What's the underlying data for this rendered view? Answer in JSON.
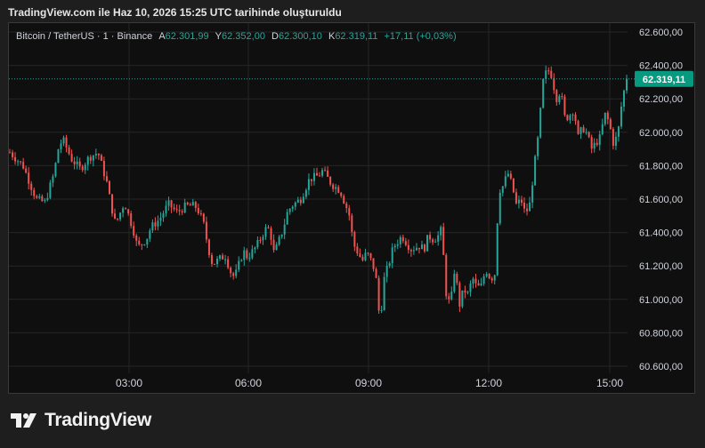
{
  "caption": "TradingView.com ile Haz 10, 2026 15:25 UTC tarihinde oluşturuldu",
  "legend": {
    "symbol": "Bitcoin / TetherUS · 1 · Binance",
    "open_label": "A",
    "open_value": "62.301,99",
    "high_label": "Y",
    "high_value": "62.352,00",
    "low_label": "D",
    "low_value": "62.300,10",
    "close_label": "K",
    "close_value": "62.319,11",
    "change": "+17,11 (+0,03%)"
  },
  "brand": {
    "name": "TradingView"
  },
  "colors": {
    "up": "#26a69a",
    "down": "#ef5350",
    "background": "#0f0f0f",
    "grid": "#262626",
    "price_badge": "#089981"
  },
  "chart_data": {
    "type": "candlestick",
    "x_ticks": [
      "03:00",
      "06:00",
      "09:00",
      "12:00",
      "15:00"
    ],
    "y_ticks": [
      "62.600,00",
      "62.400,00",
      "62.200,00",
      "62.000,00",
      "61.800,00",
      "61.600,00",
      "61.400,00",
      "61.200,00",
      "61.000,00",
      "60.800,00",
      "60.600,00"
    ],
    "ylim": [
      60600,
      62600
    ],
    "last_price": 62319.11,
    "last_price_label": "62.319,11",
    "grid": true,
    "series_close_path": [
      [
        0,
        61880
      ],
      [
        3,
        61800
      ],
      [
        6,
        61600
      ],
      [
        8,
        61580
      ],
      [
        10,
        61750
      ],
      [
        11,
        61900
      ],
      [
        12,
        61960
      ],
      [
        14,
        61840
      ],
      [
        16,
        61780
      ],
      [
        18,
        61850
      ],
      [
        20,
        61880
      ],
      [
        22,
        61700
      ],
      [
        23,
        61560
      ],
      [
        24,
        61450
      ],
      [
        26,
        61580
      ],
      [
        28,
        61420
      ],
      [
        29,
        61310
      ],
      [
        31,
        61360
      ],
      [
        32,
        61430
      ],
      [
        34,
        61480
      ],
      [
        36,
        61570
      ],
      [
        38,
        61520
      ],
      [
        40,
        61560
      ],
      [
        42,
        61560
      ],
      [
        43,
        61520
      ],
      [
        44,
        61450
      ],
      [
        45,
        61310
      ],
      [
        46,
        61210
      ],
      [
        48,
        61250
      ],
      [
        49,
        61260
      ],
      [
        50,
        61170
      ],
      [
        51,
        61130
      ],
      [
        52,
        61210
      ],
      [
        53,
        61290
      ],
      [
        54,
        61250
      ],
      [
        56,
        61320
      ],
      [
        58,
        61420
      ],
      [
        59,
        61420
      ],
      [
        60,
        61270
      ],
      [
        62,
        61420
      ],
      [
        63,
        61520
      ],
      [
        64,
        61560
      ],
      [
        66,
        61600
      ],
      [
        68,
        61720
      ],
      [
        70,
        61740
      ],
      [
        71,
        61770
      ],
      [
        73,
        61690
      ],
      [
        75,
        61650
      ],
      [
        77,
        61510
      ],
      [
        78,
        61330
      ],
      [
        80,
        61230
      ],
      [
        81,
        61280
      ],
      [
        82,
        61230
      ],
      [
        83,
        61160
      ],
      [
        84,
        60860
      ],
      [
        85,
        61130
      ],
      [
        86,
        61210
      ],
      [
        87,
        61310
      ],
      [
        89,
        61380
      ],
      [
        91,
        61300
      ],
      [
        93,
        61320
      ],
      [
        94,
        61300
      ],
      [
        95,
        61380
      ],
      [
        96,
        61360
      ],
      [
        97,
        61370
      ],
      [
        98,
        61420
      ],
      [
        99,
        61040
      ],
      [
        100,
        60960
      ],
      [
        101,
        61200
      ],
      [
        102,
        60960
      ],
      [
        103,
        61060
      ],
      [
        104,
        61030
      ],
      [
        105,
        61130
      ],
      [
        106,
        61070
      ],
      [
        107,
        61080
      ],
      [
        108,
        61180
      ],
      [
        109,
        61130
      ],
      [
        110,
        61130
      ],
      [
        111,
        61650
      ],
      [
        112,
        61680
      ],
      [
        113,
        61760
      ],
      [
        114,
        61680
      ],
      [
        115,
        61560
      ],
      [
        116,
        61600
      ],
      [
        117,
        61510
      ],
      [
        118,
        61570
      ],
      [
        119,
        61790
      ],
      [
        120,
        61990
      ],
      [
        121,
        62300
      ],
      [
        122,
        62380
      ],
      [
        123,
        62340
      ],
      [
        124,
        62200
      ],
      [
        125,
        62250
      ],
      [
        126,
        62080
      ],
      [
        127,
        62100
      ],
      [
        128,
        62140
      ],
      [
        129,
        61970
      ],
      [
        130,
        62030
      ],
      [
        131,
        61990
      ],
      [
        132,
        61900
      ],
      [
        134,
        61970
      ],
      [
        135,
        62110
      ],
      [
        136,
        62060
      ],
      [
        137,
        61930
      ],
      [
        138,
        61990
      ],
      [
        139,
        62200
      ],
      [
        140,
        62319
      ]
    ]
  }
}
